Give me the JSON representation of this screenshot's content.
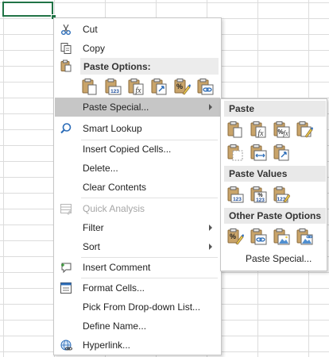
{
  "menu": {
    "items": [
      {
        "id": "cut",
        "label": "Cut",
        "icon": "scissors-icon"
      },
      {
        "id": "copy",
        "label": "Copy",
        "icon": "copy-icon"
      },
      {
        "id": "paste-special",
        "label": "Paste Special...",
        "icon": "",
        "submenu": true
      },
      {
        "id": "smart-lookup",
        "label": "Smart Lookup",
        "icon": "search-icon"
      },
      {
        "id": "insert-copied-cells",
        "label": "Insert Copied Cells..."
      },
      {
        "id": "delete",
        "label": "Delete..."
      },
      {
        "id": "clear-contents",
        "label": "Clear Contents"
      },
      {
        "id": "quick-analysis",
        "label": "Quick Analysis",
        "icon": "quick-analysis-icon",
        "disabled": true
      },
      {
        "id": "filter",
        "label": "Filter",
        "submenu": true
      },
      {
        "id": "sort",
        "label": "Sort",
        "submenu": true
      },
      {
        "id": "insert-comment",
        "label": "Insert Comment",
        "icon": "comment-icon"
      },
      {
        "id": "format-cells",
        "label": "Format Cells...",
        "icon": "format-cells-icon"
      },
      {
        "id": "pick-from-list",
        "label": "Pick From Drop-down List..."
      },
      {
        "id": "define-name",
        "label": "Define Name..."
      },
      {
        "id": "hyperlink",
        "label": "Hyperlink...",
        "icon": "hyperlink-icon"
      }
    ],
    "paste_options_header": "Paste Options:"
  },
  "submenu": {
    "paste_header": "Paste",
    "paste_values_header": "Paste Values",
    "other_paste_header": "Other Paste Options",
    "paste_special_link": "Paste Special..."
  },
  "colors": {
    "accent_green": "#217346",
    "clipboard_brown": "#c9a46a",
    "icon_blue": "#2b6cb8"
  }
}
